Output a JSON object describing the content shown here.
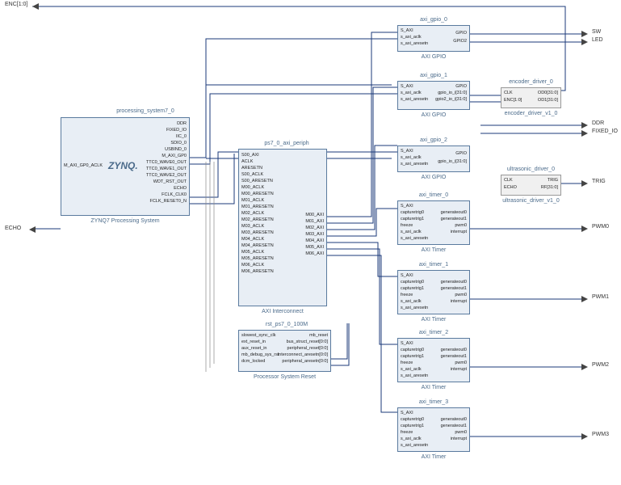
{
  "external_ports": {
    "enc": "ENC[1:0]",
    "echo": "ECHO",
    "sw": "SW",
    "led": "LED",
    "ddr": "DDR",
    "fixed_io": "FIXED_IO",
    "trig": "TRIG",
    "pwm0": "PWM0",
    "pwm1": "PWM1",
    "pwm2": "PWM2",
    "pwm3": "PWM3"
  },
  "ps7": {
    "title": "processing_system7_0",
    "type": "ZYNQ7 Processing System",
    "logo": "ZYNQ.",
    "ports_left": [
      "M_AXI_GP0_ACLK"
    ],
    "ports_right": [
      "DDR",
      "FIXED_IO",
      "IIC_0",
      "SDIO_0",
      "USBIND_0",
      "M_AXI_GP0",
      "TTC0_WAVE0_OUT",
      "TTC0_WAVE1_OUT",
      "TTC0_WAVE2_OUT",
      "WDT_RST_OUT",
      "ECHO",
      "FCLK_CLK0",
      "FCLK_RESET0_N"
    ]
  },
  "interconnect": {
    "title": "ps7_0_axi_periph",
    "type": "AXI Interconnect",
    "ports_left": [
      "S00_AXI",
      "ACLK",
      "ARESETN",
      "S00_ACLK",
      "S00_ARESETN",
      "M00_ACLK",
      "M00_ARESETN",
      "M01_ACLK",
      "M01_ARESETN",
      "M02_ACLK",
      "M02_ARESETN",
      "M03_ACLK",
      "M03_ARESETN",
      "M04_ACLK",
      "M04_ARESETN",
      "M05_ACLK",
      "M05_ARESETN",
      "M06_ACLK",
      "M06_ARESETN"
    ],
    "ports_right": [
      "M00_AXI",
      "M01_AXI",
      "M02_AXI",
      "M03_AXI",
      "M04_AXI",
      "M05_AXI",
      "M06_AXI"
    ]
  },
  "reset": {
    "title": "rst_ps7_0_100M",
    "type": "Processor System Reset",
    "ports_left": [
      "slowest_sync_clk",
      "ext_reset_in",
      "aux_reset_in",
      "mb_debug_sys_rst",
      "dcm_locked"
    ],
    "ports_right": [
      "mb_reset",
      "bus_struct_reset[0:0]",
      "peripheral_reset[0:0]",
      "interconnect_aresetn[0:0]",
      "peripheral_aresetn[0:0]"
    ]
  },
  "gpio0": {
    "title": "axi_gpio_0",
    "type": "AXI GPIO",
    "ports_left": [
      "S_AXI",
      "s_axi_aclk",
      "s_axi_aresetn"
    ],
    "ports_right": [
      "GPIO",
      "GPIO2"
    ]
  },
  "gpio1": {
    "title": "axi_gpio_1",
    "type": "AXI GPIO",
    "ports_left": [
      "S_AXI",
      "s_axi_aclk",
      "s_axi_aresetn"
    ],
    "ports_right": [
      "GPIO",
      "gpio_io_i[31:0]",
      "gpio2_io_i[31:0]"
    ]
  },
  "gpio2": {
    "title": "axi_gpio_2",
    "type": "AXI GPIO",
    "ports_left": [
      "S_AXI",
      "s_axi_aclk",
      "s_axi_aresetn"
    ],
    "ports_right": [
      "GPIO",
      "gpio_io_i[31:0]"
    ]
  },
  "timer0": {
    "title": "axi_timer_0",
    "type": "AXI Timer",
    "ports_left": [
      "S_AXI",
      "capturetrig0",
      "capturetrig1",
      "freeze",
      "s_axi_aclk",
      "s_axi_aresetn"
    ],
    "ports_right": [
      "generateout0",
      "generateout1",
      "pwm0",
      "interrupt"
    ]
  },
  "timer1": {
    "title": "axi_timer_1",
    "type": "AXI Timer",
    "ports_left": [
      "S_AXI",
      "capturetrig0",
      "capturetrig1",
      "freeze",
      "s_axi_aclk",
      "s_axi_aresetn"
    ],
    "ports_right": [
      "generateout0",
      "generateout1",
      "pwm0",
      "interrupt"
    ]
  },
  "timer2": {
    "title": "axi_timer_2",
    "type": "AXI Timer",
    "ports_left": [
      "S_AXI",
      "capturetrig0",
      "capturetrig1",
      "freeze",
      "s_axi_aclk",
      "s_axi_aresetn"
    ],
    "ports_right": [
      "generateout0",
      "generateout1",
      "pwm0",
      "interrupt"
    ]
  },
  "timer3": {
    "title": "axi_timer_3",
    "type": "AXI Timer",
    "ports_left": [
      "S_AXI",
      "capturetrig0",
      "capturetrig1",
      "freeze",
      "s_axi_aclk",
      "s_axi_aresetn"
    ],
    "ports_right": [
      "generateout0",
      "generateout1",
      "pwm0",
      "interrupt"
    ]
  },
  "encoder": {
    "title": "encoder_driver_0",
    "type": "encoder_driver_v1_0",
    "ports_left": [
      "CLK",
      "ENC[1:0]"
    ],
    "ports_right": [
      "OD0[31:0]",
      "OD1[31:0]"
    ]
  },
  "ultrasonic": {
    "title": "ultrasonic_driver_0",
    "type": "ultrasonic_driver_v1_0",
    "ports_left": [
      "CLK",
      "ECHO"
    ],
    "ports_right": [
      "TRIG",
      "RF[31:0]"
    ]
  }
}
